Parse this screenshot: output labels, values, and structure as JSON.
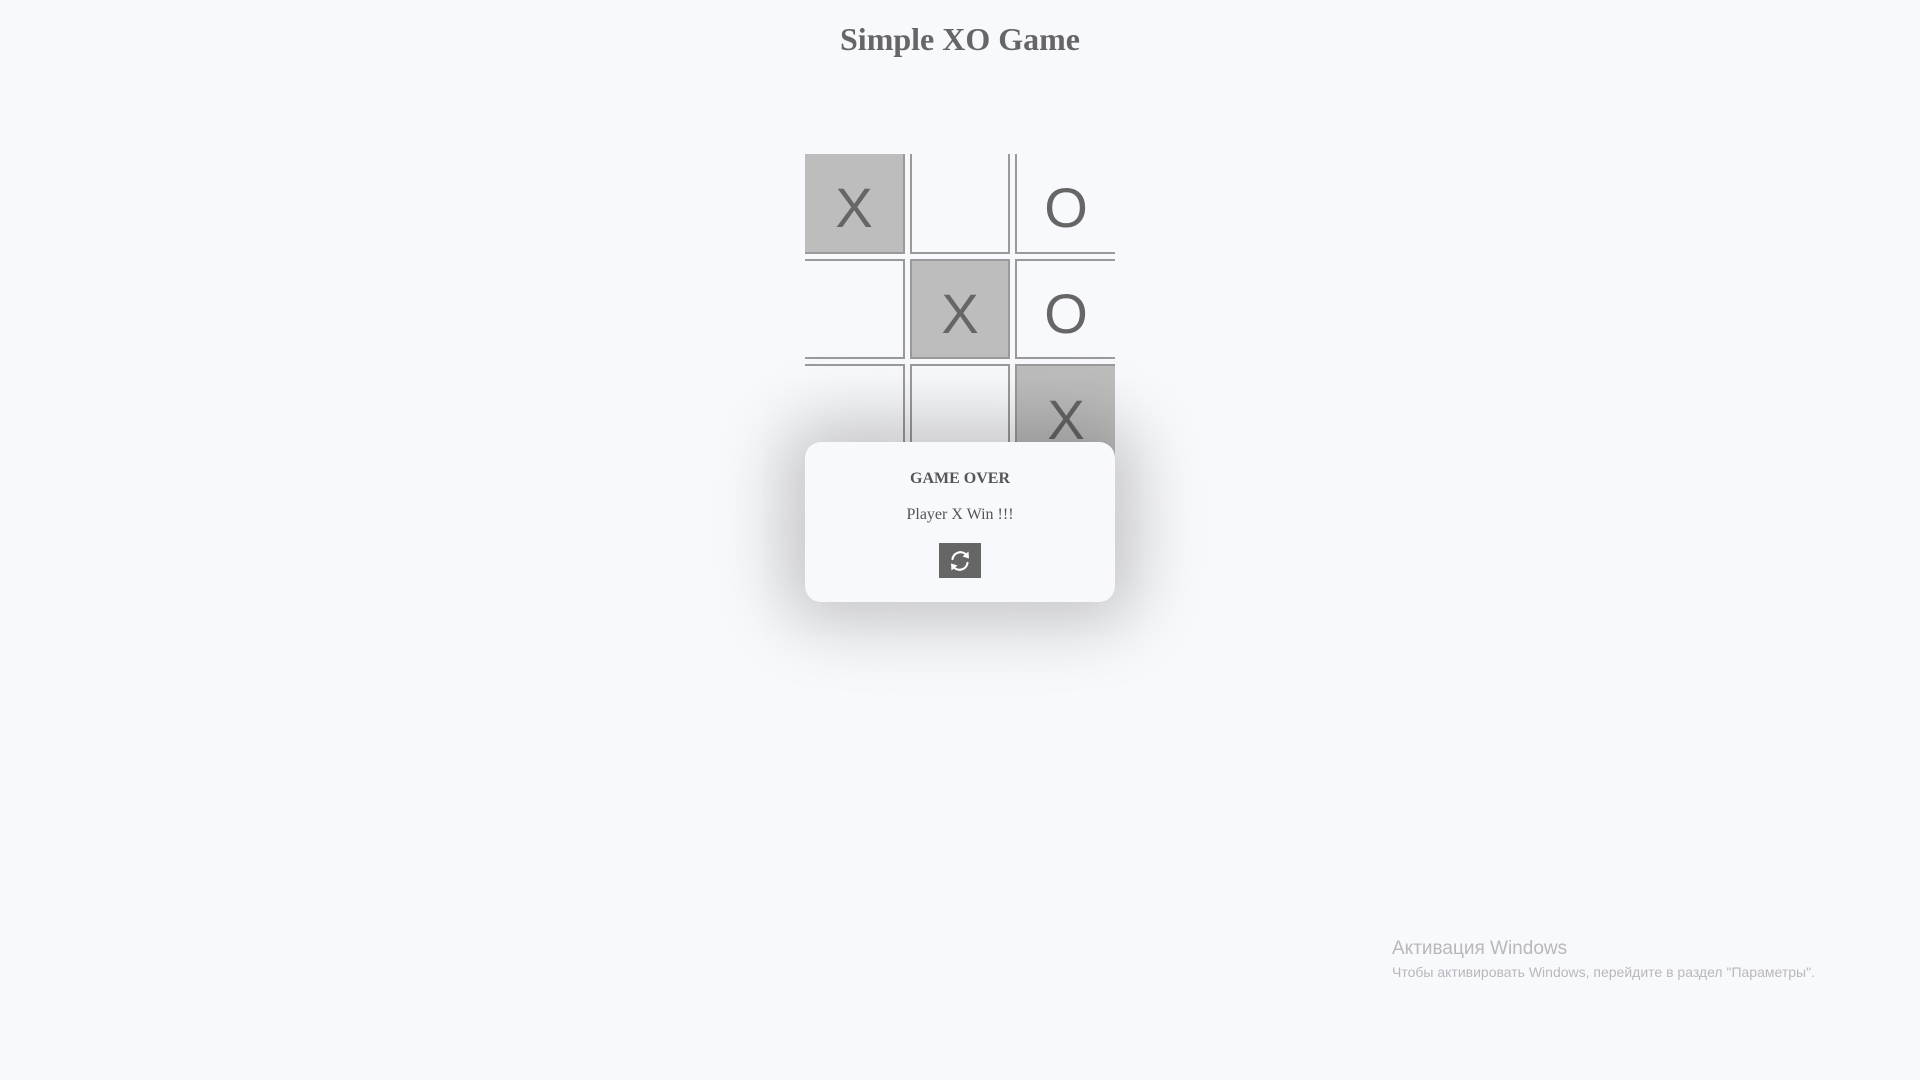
{
  "title": "Simple XO Game",
  "board": {
    "cells": [
      "X",
      "",
      "O",
      "",
      "X",
      "O",
      "",
      "",
      "X"
    ],
    "winning_cells": [
      0,
      4,
      8
    ]
  },
  "modal": {
    "heading": "GAME OVER",
    "message": "Player X Win !!!",
    "restart_icon": "refresh-icon"
  },
  "watermark": {
    "title": "Активация Windows",
    "subtitle": "Чтобы активировать Windows, перейдите в раздел \"Параметры\"."
  },
  "colors": {
    "background": "#f8f9fd",
    "text": "#666666",
    "filled_cell": "#bdbdbd",
    "grid_line": "#9a9a9a",
    "button": "#666666"
  }
}
